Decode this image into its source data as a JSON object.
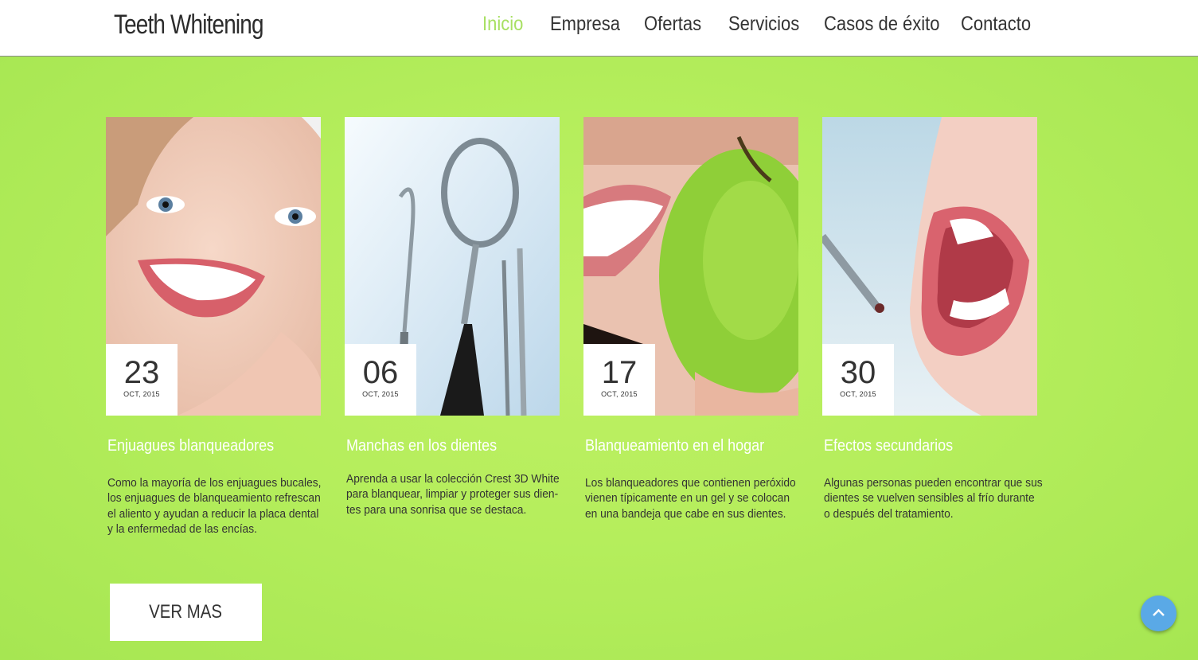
{
  "header": {
    "logo": "Teeth Whitening",
    "nav": [
      "Inicio",
      "Empresa",
      "Ofertas",
      "Servicios",
      "Casos de éxito",
      "Contacto"
    ],
    "active_index": 0
  },
  "cards": [
    {
      "day": "23",
      "month_year": "OCT, 2015",
      "title": "Enjuagues blanqueadores",
      "description": "Como la mayoría de los enjuagues bucales, los enjuagues de blanqueamiento refrescan el aliento y ayudan a reducir la placa dental y la enfermedad de las encías."
    },
    {
      "day": "06",
      "month_year": "OCT, 2015",
      "title": "Manchas en los dientes",
      "description": "Aprenda a usar la colección Crest 3D White para blanquear, limpiar y proteger sus dien-tes para una sonrisa que se destaca."
    },
    {
      "day": "17",
      "month_year": "OCT, 2015",
      "title": "Blanqueamiento en el hogar",
      "description": "Los blanqueadores que contienen peróxido vienen típicamente en un gel y se colocan en una bandeja que cabe en sus dientes."
    },
    {
      "day": "30",
      "month_year": "OCT, 2015",
      "title": "Efectos secundarios",
      "description": "Algunas personas pueden encontrar que sus dientes se vuelven sensibles al frío durante o después del tratamiento."
    }
  ],
  "buttons": {
    "ver_mas": "VER MAS",
    "scroll_top_icon": "chevron-up-icon"
  },
  "colors": {
    "accent": "#a8e063",
    "background": "#b3ec5a",
    "scroll_button": "#5aa9e6"
  }
}
